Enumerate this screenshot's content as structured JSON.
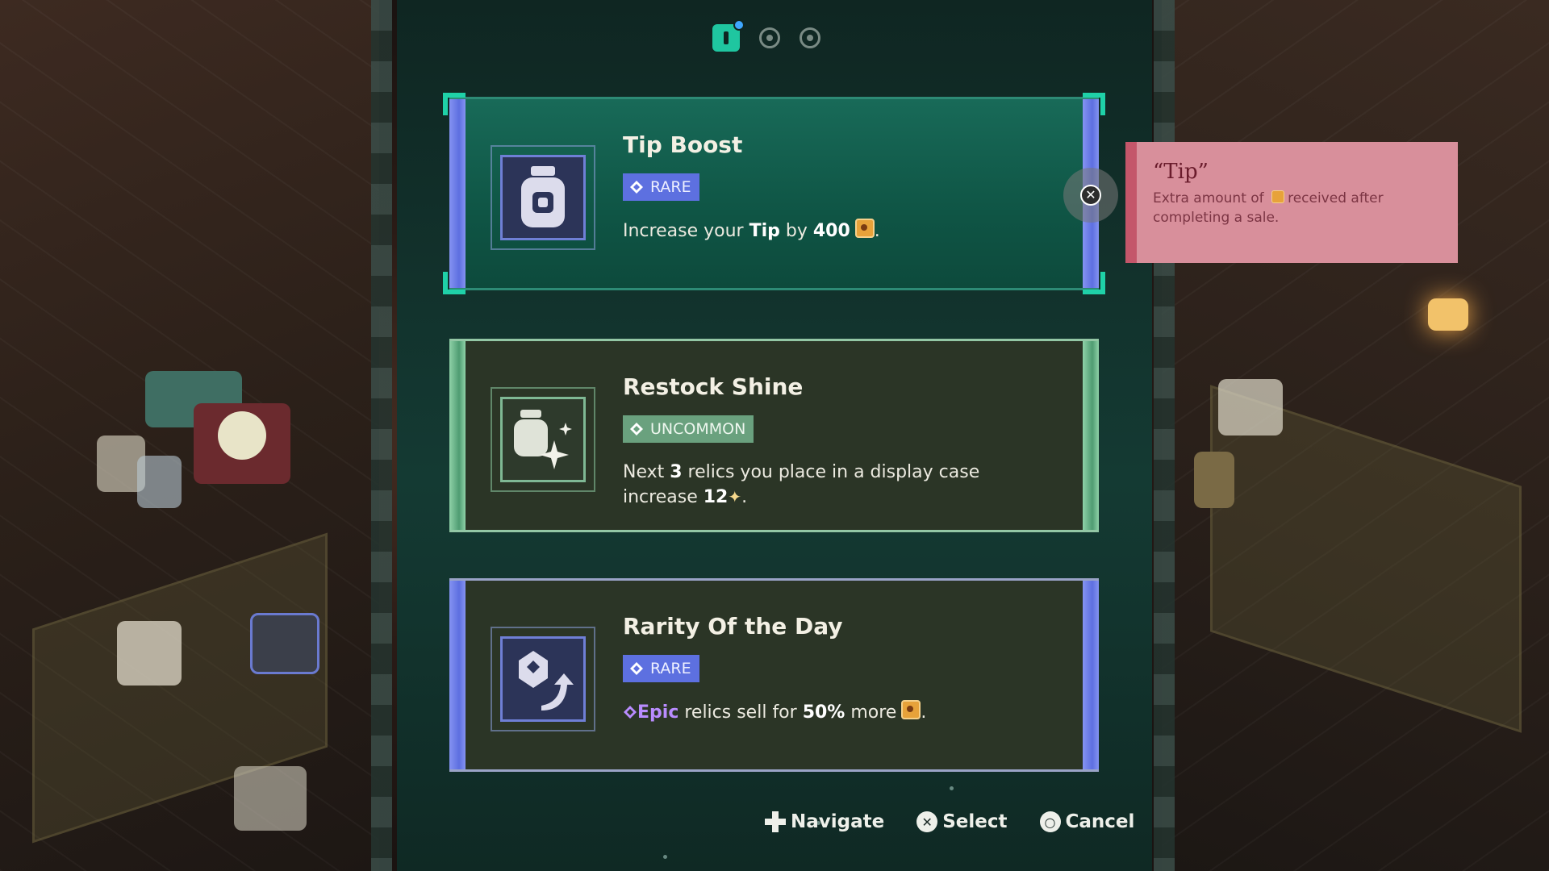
{
  "pager": {
    "active_index": 0,
    "count": 3
  },
  "cards": [
    {
      "title": "Tip Boost",
      "rarity": "RARE",
      "icon": "jar-icon",
      "desc": {
        "pre": "Increase your ",
        "bold1": "Tip",
        "mid": " by ",
        "bold2": "400",
        "post": "."
      },
      "selected": true
    },
    {
      "title": "Restock Shine",
      "rarity": "UNCOMMON",
      "icon": "sparkle-jar-icon",
      "desc": {
        "pre": "Next ",
        "bold1": "3",
        "mid": " relics you place in a display case increase ",
        "bold2": "12",
        "post": "."
      }
    },
    {
      "title": "Rarity Of the Day",
      "rarity": "RARE",
      "icon": "rarity-upgrade-icon",
      "desc": {
        "epic": "Epic",
        "mid": " relics sell for ",
        "bold2": "50%",
        "more": " more",
        "post": "."
      }
    }
  ],
  "tooltip": {
    "title": "“Tip”",
    "desc_pre": "Extra amount of ",
    "desc_post": "received after completing a sale."
  },
  "hints": {
    "navigate": "Navigate",
    "select": "Select",
    "cancel": "Cancel"
  },
  "colors": {
    "rare": "#5d70e0",
    "uncommon": "#6aa17e",
    "epic": "#b98cff",
    "tooltip_bg": "#d88f9b",
    "accent": "#1fc6a0"
  }
}
